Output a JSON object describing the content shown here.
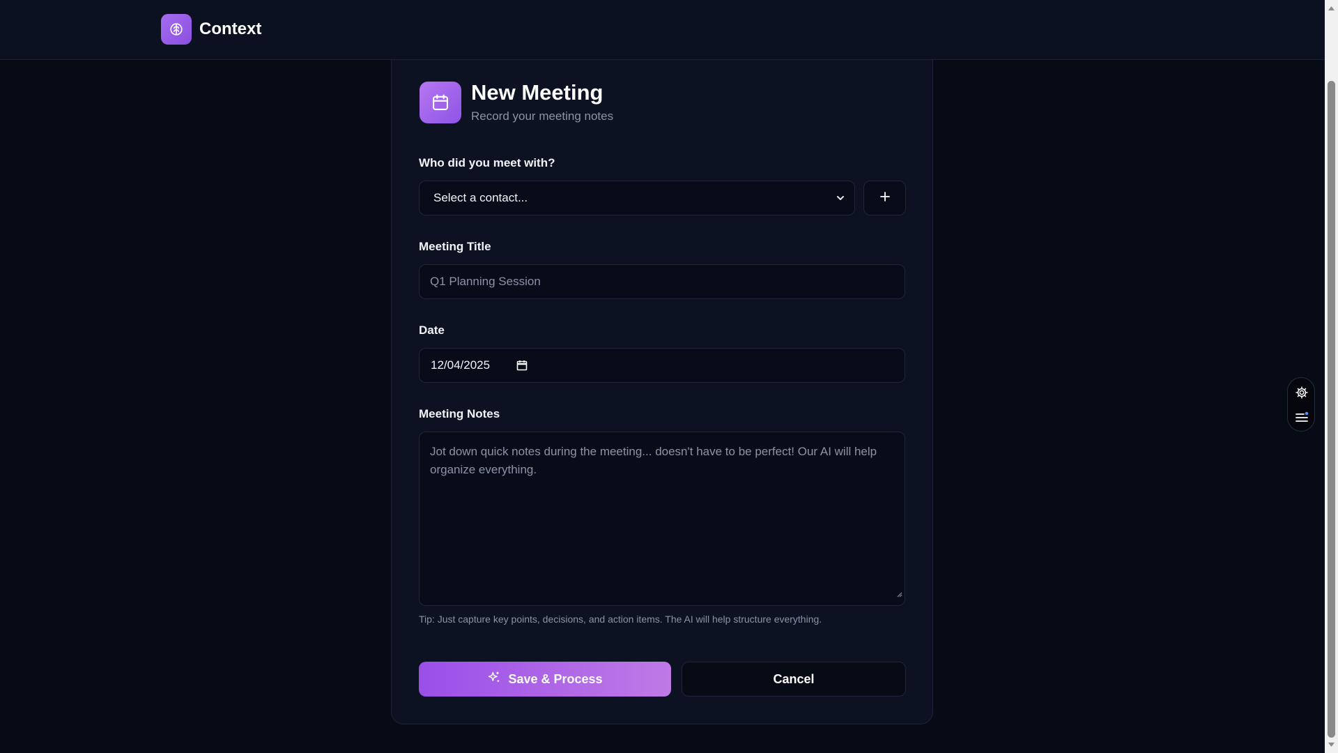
{
  "app": {
    "name": "Context"
  },
  "header": {
    "title": "New Meeting",
    "subtitle": "Record your meeting notes"
  },
  "contact": {
    "label": "Who did you meet with?",
    "selected": "Select a contact..."
  },
  "meeting_title": {
    "label": "Meeting Title",
    "placeholder": "Q1 Planning Session"
  },
  "date": {
    "label": "Date",
    "value": "12/04/2025"
  },
  "notes": {
    "label": "Meeting Notes",
    "placeholder": "Jot down quick notes during the meeting... doesn't have to be perfect! Our AI will help organize everything.",
    "tip": "Tip: Just capture key points, decisions, and action items. The AI will help structure everything."
  },
  "actions": {
    "save": "Save & Process",
    "cancel": "Cancel"
  },
  "icons": {
    "brand": "brain-icon",
    "header": "calendar-icon",
    "add": "plus-icon",
    "date_picker": "calendar-icon",
    "save": "sparkles-icon",
    "settings": "gear-icon",
    "menu": "menu-icon"
  },
  "colors": {
    "accent": "#9a4fe8",
    "accent_light": "#c07ae6",
    "background": "#070b16",
    "card": "#0c1221"
  }
}
